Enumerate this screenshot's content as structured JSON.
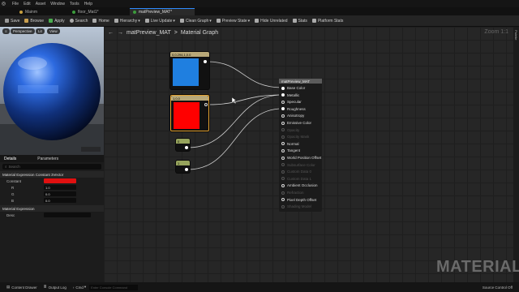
{
  "menu": {
    "items": [
      "File",
      "Edit",
      "Asset",
      "Window",
      "Tools",
      "Help"
    ]
  },
  "tabs": [
    {
      "label": "Mainm"
    },
    {
      "label": "floor_Mat1*"
    },
    {
      "label": "matPreview_MAT*"
    }
  ],
  "toolbar": {
    "save": "Save",
    "browse": "Browse",
    "apply": "Apply",
    "search": "Search",
    "home": "Home",
    "hierarchy": "Hierarchy",
    "live_update": "Live Update",
    "clean_graph": "Clean Graph",
    "preview_state": "Preview State",
    "hide_unrelated": "Hide Unrelated",
    "stats": "Stats",
    "platform_stats": "Platform Stats"
  },
  "viewport": {
    "perspective": "Perspective",
    "lit": "Lit",
    "view": "View"
  },
  "details": {
    "tab_details": "Details",
    "tab_parameters": "Parameters",
    "search_placeholder": "Search",
    "section1": "Material Expression Constant 3Vector",
    "constant_label": "Constant",
    "r_label": "R",
    "r_value": "1.0",
    "g_label": "G",
    "g_value": "0.0",
    "b_label": "B",
    "b_value": "0.0",
    "section2": "Material Expression",
    "desc_label": "Desc",
    "constant_color": "#e01010"
  },
  "graph": {
    "breadcrumb_root": "matPreview_MAT",
    "breadcrumb_sep": ">",
    "breadcrumb_page": "Material Graph",
    "zoom": "Zoom 1:1",
    "side_tab": "Palette",
    "watermark": "MATERIAL"
  },
  "nodes": {
    "blue_title": "0,0.294,1,0.0",
    "red_title": "1,0,0",
    "const1_a": "0",
    "const2_a": "1",
    "blue_color": "#1f7fe0",
    "red_color": "#ff0000",
    "material": {
      "title": "matPreview_MAT",
      "inputs": [
        {
          "label": "Base Color",
          "connected": true
        },
        {
          "label": "Metallic",
          "connected": true
        },
        {
          "label": "Specular",
          "connected": false
        },
        {
          "label": "Roughness",
          "connected": true
        },
        {
          "label": "Anisotropy",
          "connected": false
        },
        {
          "label": "Emissive Color",
          "connected": false
        },
        {
          "label": "Opacity",
          "connected": false,
          "dim": true
        },
        {
          "label": "Opacity Mask",
          "connected": false,
          "dim": true
        },
        {
          "label": "Normal",
          "connected": false
        },
        {
          "label": "Tangent",
          "connected": false
        },
        {
          "label": "World Position Offset",
          "connected": false
        },
        {
          "label": "Subsurface Color",
          "connected": false,
          "dim": true
        },
        {
          "label": "Custom Data 0",
          "connected": false,
          "dim": true
        },
        {
          "label": "Custom Data 1",
          "connected": false,
          "dim": true
        },
        {
          "label": "Ambient Occlusion",
          "connected": false
        },
        {
          "label": "Refraction",
          "connected": false,
          "dim": true
        },
        {
          "label": "Pixel Depth Offset",
          "connected": false
        },
        {
          "label": "Shading Model",
          "connected": false,
          "dim": true
        }
      ]
    }
  },
  "status": {
    "content_drawer": "Content Drawer",
    "output_log": "Output Log",
    "cmd": "Cmd",
    "cmd_placeholder": "Enter Console Command",
    "source_control": "Source Control Off"
  }
}
